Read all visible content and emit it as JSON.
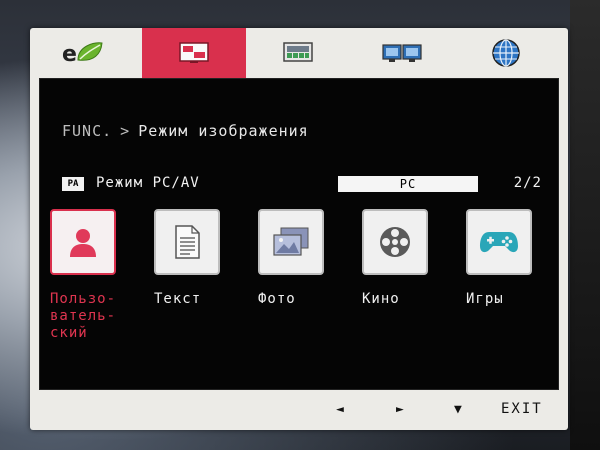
{
  "tabs": [
    {
      "icon": "eco-icon",
      "active": false
    },
    {
      "icon": "picture-icon",
      "active": true
    },
    {
      "icon": "display-icon",
      "active": false
    },
    {
      "icon": "dual-screen-icon",
      "active": false
    },
    {
      "icon": "globe-icon",
      "active": false
    }
  ],
  "breadcrumb": {
    "root": "FUNC.",
    "separator": ">",
    "current": "Режим изображения"
  },
  "picture_mode": {
    "badge": "PA",
    "label": "Режим PC/AV",
    "value": "PC",
    "page": "2/2"
  },
  "modes": [
    {
      "label": "Пользо-\nватель-\nский",
      "icon": "user-icon",
      "selected": true
    },
    {
      "label": "Текст",
      "icon": "document-icon",
      "selected": false
    },
    {
      "label": "Фото",
      "icon": "photo-icon",
      "selected": false
    },
    {
      "label": "Кино",
      "icon": "film-reel-icon",
      "selected": false
    },
    {
      "label": "Игры",
      "icon": "gamepad-icon",
      "selected": false
    }
  ],
  "bottom": {
    "left": "◄",
    "right": "►",
    "down": "▼",
    "exit": "EXIT"
  },
  "colors": {
    "accent": "#d9304d",
    "frame": "#ecebe7",
    "panel": "#050505"
  }
}
